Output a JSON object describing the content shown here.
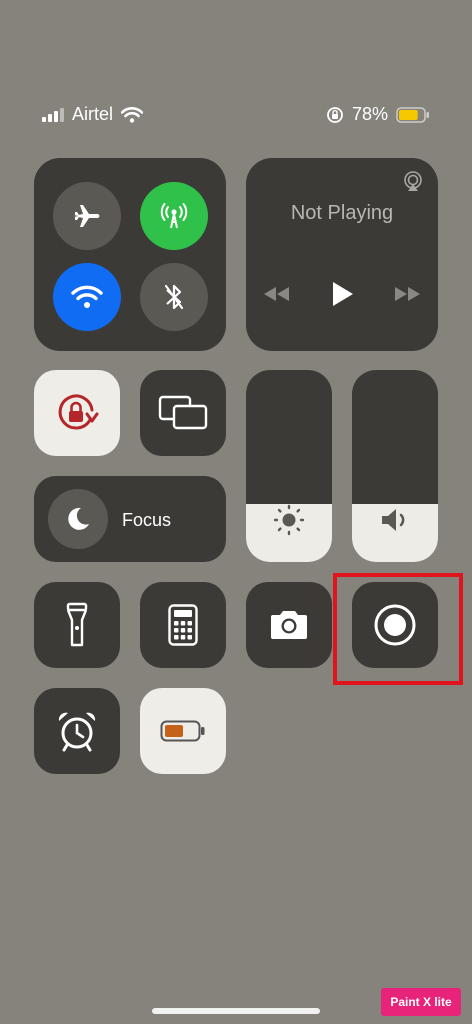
{
  "status_bar": {
    "carrier": "Airtel",
    "battery_percent": "78%",
    "battery_level": 0.78,
    "battery_color": "#f6c800"
  },
  "connectivity": {
    "airplane_mode": {
      "state": "off",
      "icon": "airplane-icon"
    },
    "cellular_data": {
      "state": "on",
      "icon": "antenna-icon",
      "color": "#2fc14a"
    },
    "wifi": {
      "state": "on",
      "icon": "wifi-icon",
      "color": "#0f6cf3"
    },
    "bluetooth": {
      "state": "off",
      "icon": "bluetooth-icon"
    }
  },
  "media": {
    "title": "Not Playing",
    "controls": [
      "rewind-icon",
      "play-icon",
      "fast-forward-icon"
    ],
    "airplay_icon": "airplay-icon"
  },
  "controls": {
    "orientation_lock": {
      "icon": "rotation-lock-icon",
      "state": "on",
      "color": "#b5262a"
    },
    "screen_mirroring": {
      "icon": "screen-mirroring-icon"
    },
    "focus": {
      "label": "Focus",
      "icon": "moon-icon"
    },
    "brightness": {
      "icon": "sun-icon",
      "level": 0.3
    },
    "volume": {
      "icon": "speaker-icon",
      "level": 0.3
    },
    "flashlight": {
      "icon": "flashlight-icon"
    },
    "calculator": {
      "icon": "calculator-icon"
    },
    "camera": {
      "icon": "camera-icon"
    },
    "screen_recording": {
      "icon": "record-icon",
      "highlighted": true,
      "highlight_color": "#e0141c"
    },
    "alarm": {
      "icon": "alarm-clock-icon"
    },
    "low_power_mode": {
      "icon": "battery-icon",
      "state": "on",
      "color": "#c4621a"
    }
  },
  "watermark": "Paint X lite"
}
